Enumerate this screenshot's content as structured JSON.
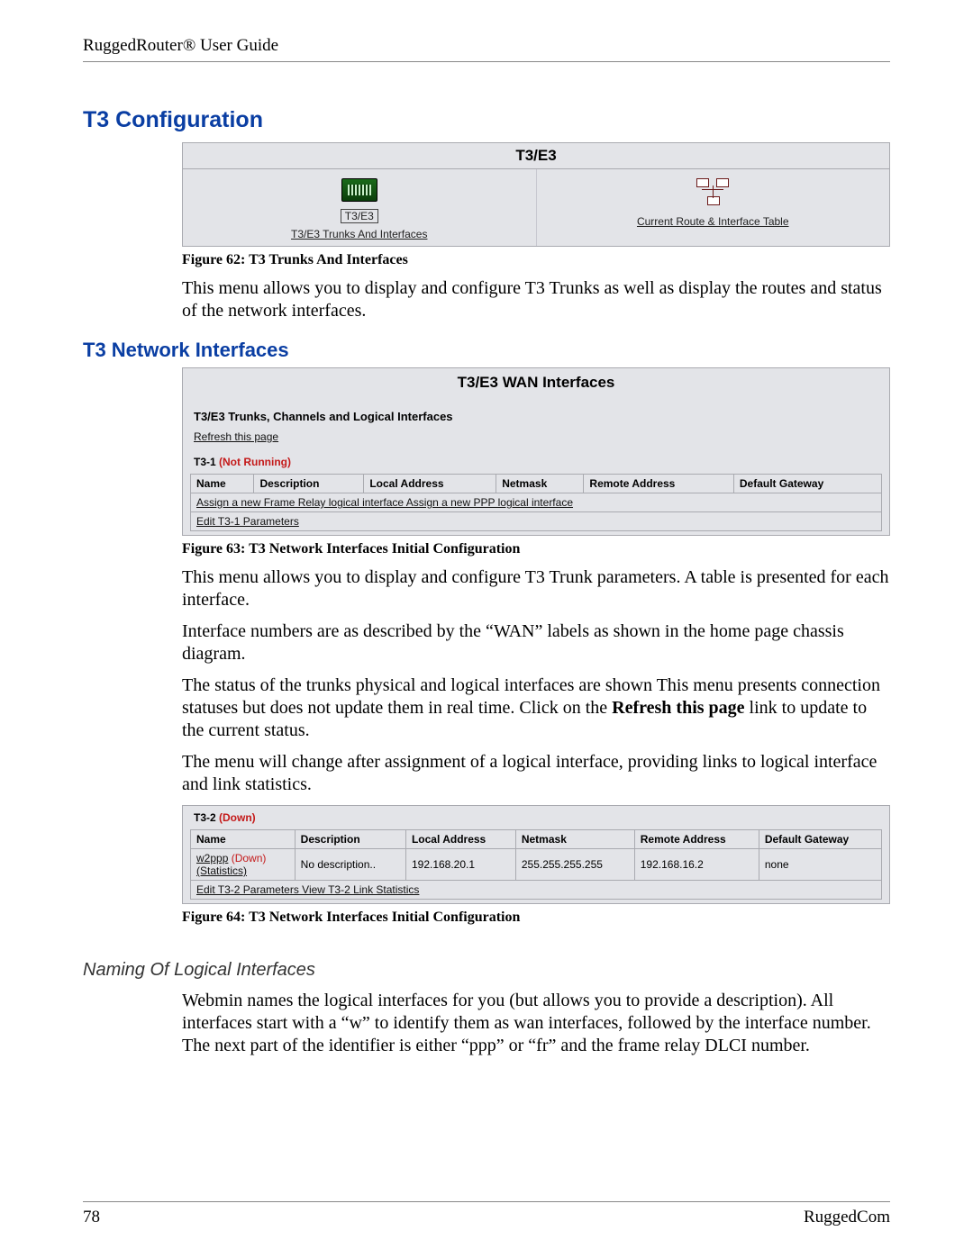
{
  "header": {
    "title": "RuggedRouter® User Guide"
  },
  "h1": "T3 Configuration",
  "fig62": {
    "title": "T3/E3",
    "cell1": {
      "label": "T3/E3",
      "link": "T3/E3 Trunks And Interfaces"
    },
    "cell2": {
      "link": "Current Route & Interface Table"
    },
    "caption": "Figure 62: T3 Trunks And Interfaces"
  },
  "para1": "This menu allows you to display and configure T3 Trunks as well as display the routes and status of the network interfaces.",
  "h2a": "T3 Network Interfaces",
  "fig63": {
    "title": "T3/E3 WAN Interfaces",
    "sub": "T3/E3 Trunks, Channels and Logical Interfaces",
    "refresh": "Refresh this page",
    "trunk": "T3-1 ",
    "trunk_status": "(Not Running)",
    "cols": {
      "name": "Name",
      "desc": "Description",
      "la": "Local Address",
      "nm": "Netmask",
      "ra": "Remote Address",
      "gw": "Default Gateway"
    },
    "rowlinks": "Assign a new Frame Relay logical interface Assign a new PPP logical interface",
    "editlink": "Edit T3-1 Parameters",
    "caption": "Figure 63: T3 Network Interfaces Initial Configuration"
  },
  "para2": "This menu allows you to display and configure T3 Trunk parameters.  A table is presented for each interface.",
  "para3": "Interface numbers are as described by the “WAN” labels as shown in the home page chassis diagram.",
  "para4a": "The status of the trunks physical and logical interfaces are shown This menu presents connection statuses but does not update them in real time.  Click on the ",
  "para4b": "Refresh this page",
  "para4c": " link to update to the current status.",
  "para5": "The menu will change after assignment of a logical interface, providing links to logical interface and link statistics.",
  "fig64": {
    "trunk": "T3-2 ",
    "trunk_status": "(Down)",
    "cols": {
      "name": "Name",
      "desc": "Description",
      "la": "Local Address",
      "nm": "Netmask",
      "ra": "Remote Address",
      "gw": "Default Gateway"
    },
    "row": {
      "name1": "w2ppp",
      "name_status": "(Down)",
      "name2": "(Statistics)",
      "desc": "No description..",
      "la": "192.168.20.1",
      "nm": "255.255.255.255",
      "ra": "192.168.16.2",
      "gw": "none"
    },
    "editlink": "Edit T3-2 Parameters View T3-2 Link Statistics",
    "caption": "Figure 64: T3 Network Interfaces Initial Configuration"
  },
  "h3": "Naming Of Logical Interfaces",
  "para6": "Webmin names the logical interfaces for you (but allows you to provide a description).  All interfaces start with a “w” to identify them as wan interfaces, followed by the interface number. The next part of the identifier is either “ppp” or “fr” and the frame relay DLCI number.",
  "footer": {
    "page": "78",
    "brand": "RuggedCom"
  }
}
